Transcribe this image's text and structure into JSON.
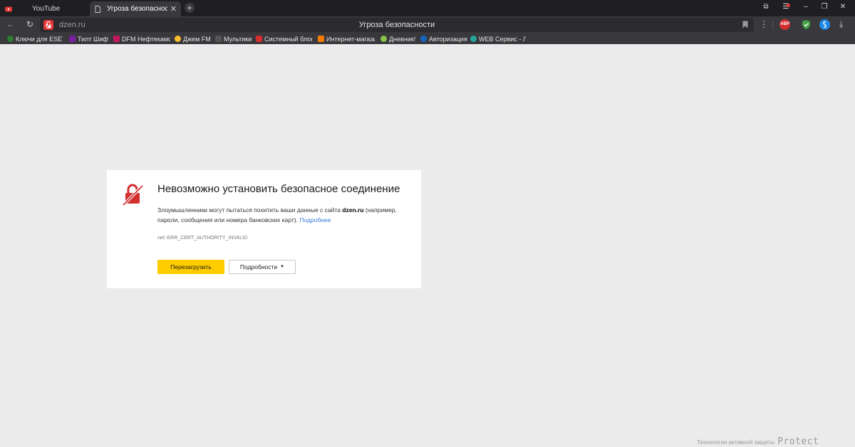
{
  "tabs": [
    {
      "label": "YouTube",
      "icon": "youtube-icon",
      "active": false
    },
    {
      "label": "Угроза безопасности",
      "icon": "page-icon",
      "active": true
    }
  ],
  "tab_close_glyph": "✕",
  "new_tab_glyph": "+",
  "window_controls": {
    "menu": "☰",
    "minimize": "–",
    "restore": "❐",
    "close": "✕",
    "bookmarks_panel": "⧉"
  },
  "nav": {
    "back": "←",
    "reload": "↻"
  },
  "omnibox": {
    "domain": "dzen.ru",
    "title": "Угроза безопасности",
    "menu": "⋮",
    "download": "⤓"
  },
  "extensions": {
    "abp": "ABP"
  },
  "bookmarks": [
    {
      "label": "Ключи для ESET N",
      "color": "#2e7d32"
    },
    {
      "label": "Тилт Шифт",
      "color": "#7b1fa2"
    },
    {
      "label": "DFM Нефтекамск",
      "color": "#c2185b"
    },
    {
      "label": "Джем FM",
      "color": "#fbc02d"
    },
    {
      "label": "Мультики",
      "color": "#555555"
    },
    {
      "label": "Системный блок |",
      "color": "#d32f2f"
    },
    {
      "label": "Интернет-магази",
      "color": "#f57c00"
    },
    {
      "label": "Дневник!",
      "color": "#8bc34a"
    },
    {
      "label": "Авторизация",
      "color": "#1565c0"
    },
    {
      "label": "WEB Сервис - Ли",
      "color": "#26a69a"
    }
  ],
  "error": {
    "title": "Невозможно установить безопасное соединение",
    "desc_before": "Злоумышленники могут пытаться похитить ваши данные с сайта ",
    "site": "dzen.ru",
    "desc_after": " (например, пароли, сообщения или номера банковских карт). ",
    "more_link": "Подробнее",
    "code": "net::ERR_CERT_AUTHORITY_INVALID",
    "reload_button": "Перезагрузить",
    "details_button": "Подробности",
    "details_caret": "▼"
  },
  "footer": {
    "text": "Технология активной защиты",
    "logo": "Protect"
  },
  "colors": {
    "accent_yellow": "#ffcc00",
    "error_red": "#d32f2f",
    "link_blue": "#3b7ddd",
    "page_bg": "#ebebeb"
  }
}
